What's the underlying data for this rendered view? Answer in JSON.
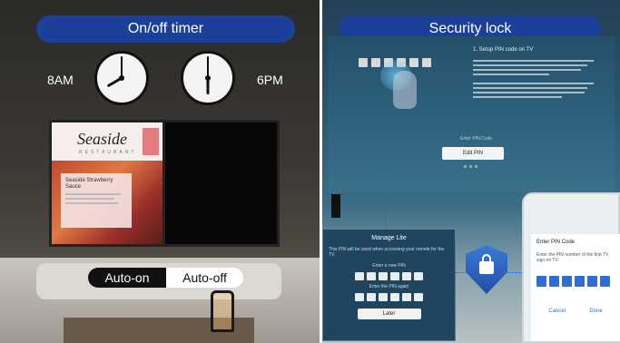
{
  "left_panel": {
    "title": "On/off timer",
    "time_on": "8AM",
    "time_off": "6PM",
    "tv_content": {
      "logo": "Seaside",
      "logo_sub": "RESTAURANT",
      "recipe_title": "Seaside Strawberry Sauce"
    },
    "toggle": {
      "on_label": "Auto-on",
      "off_label": "Auto-off"
    }
  },
  "right_panel": {
    "title": "Security lock",
    "tv_screen": {
      "step_title": "1. Setup PIN code on TV",
      "hint": "Enter PIN Code",
      "edit_button": "Edit PIN"
    },
    "tv_dialog": {
      "title": "Manage Lite",
      "desc": "This PIN will be used when accessing your remote for the TV.",
      "label_new": "Enter a new PIN",
      "label_confirm": "Enter the PIN again",
      "button": "Later"
    },
    "phone": {
      "title": "Enter PIN Code",
      "desc": "Enter the PIN number of the first TV sign on TV.",
      "cancel": "Cancel",
      "done": "Done"
    }
  },
  "colors": {
    "title_pill": "#1c3f9a",
    "accent_blue": "#2a6fd6"
  },
  "icons": [
    "clock-icon",
    "hand-icon",
    "shield-lock-icon",
    "lantern-icon"
  ]
}
